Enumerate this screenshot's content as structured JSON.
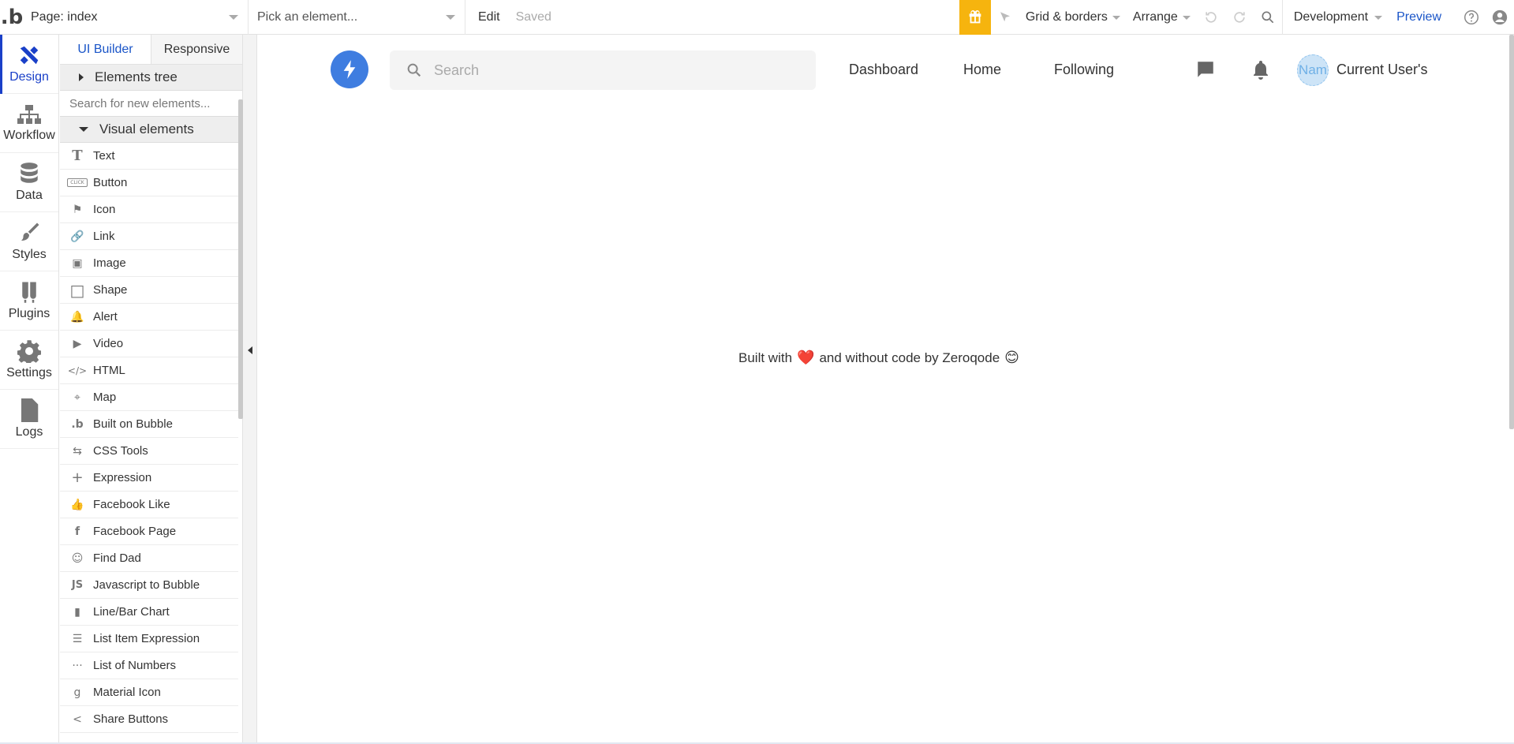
{
  "topbar": {
    "page_selector": "Page: index",
    "element_picker": "Pick an element...",
    "edit_label": "Edit",
    "saved_status": "Saved",
    "grid_borders_label": "Grid & borders",
    "arrange_label": "Arrange",
    "environment_label": "Development",
    "preview_label": "Preview",
    "gift_color": "#f6b40e"
  },
  "rail": {
    "items": [
      {
        "label": "Design",
        "icon": "design-icon"
      },
      {
        "label": "Workflow",
        "icon": "workflow-icon"
      },
      {
        "label": "Data",
        "icon": "database-icon"
      },
      {
        "label": "Styles",
        "icon": "brush-icon"
      },
      {
        "label": "Plugins",
        "icon": "plug-icon"
      },
      {
        "label": "Settings",
        "icon": "gear-icon"
      },
      {
        "label": "Logs",
        "icon": "document-icon"
      }
    ],
    "active_color": "#1a40c8"
  },
  "palette": {
    "tab_ui_builder": "UI Builder",
    "tab_responsive": "Responsive",
    "elements_tree_label": "Elements tree",
    "search_placeholder": "Search for new elements...",
    "visual_elements_label": "Visual elements",
    "items": [
      {
        "label": "Text",
        "icon": "T"
      },
      {
        "label": "Button",
        "icon": "CLICK"
      },
      {
        "label": "Icon",
        "icon": "⚑"
      },
      {
        "label": "Link",
        "icon": "🔗"
      },
      {
        "label": "Image",
        "icon": "▣"
      },
      {
        "label": "Shape",
        "icon": "□"
      },
      {
        "label": "Alert",
        "icon": "🔔"
      },
      {
        "label": "Video",
        "icon": "▶"
      },
      {
        "label": "HTML",
        "icon": "</>"
      },
      {
        "label": "Map",
        "icon": "⌖"
      },
      {
        "label": "Built on Bubble",
        "icon": ".b"
      },
      {
        "label": "CSS Tools",
        "icon": "⇆"
      },
      {
        "label": "Expression",
        "icon": "+"
      },
      {
        "label": "Facebook Like",
        "icon": "👍"
      },
      {
        "label": "Facebook Page",
        "icon": "f"
      },
      {
        "label": "Find Dad",
        "icon": "☺"
      },
      {
        "label": "Javascript to Bubble",
        "icon": "JS"
      },
      {
        "label": "Line/Bar Chart",
        "icon": "▮"
      },
      {
        "label": "List Item Expression",
        "icon": "☰"
      },
      {
        "label": "List of Numbers",
        "icon": "···"
      },
      {
        "label": "Material Icon",
        "icon": "g"
      },
      {
        "label": "Share Buttons",
        "icon": "<"
      }
    ]
  },
  "app": {
    "search_placeholder": "Search",
    "nav": [
      "Dashboard",
      "Home",
      "Following"
    ],
    "avatar_text": "Nam",
    "user_name": "Current User's",
    "brand_color": "#3f7de0",
    "footer_before": "Built with",
    "footer_heart": "❤️",
    "footer_after": "and without code by Zeroqode",
    "footer_emoji": "😊"
  }
}
